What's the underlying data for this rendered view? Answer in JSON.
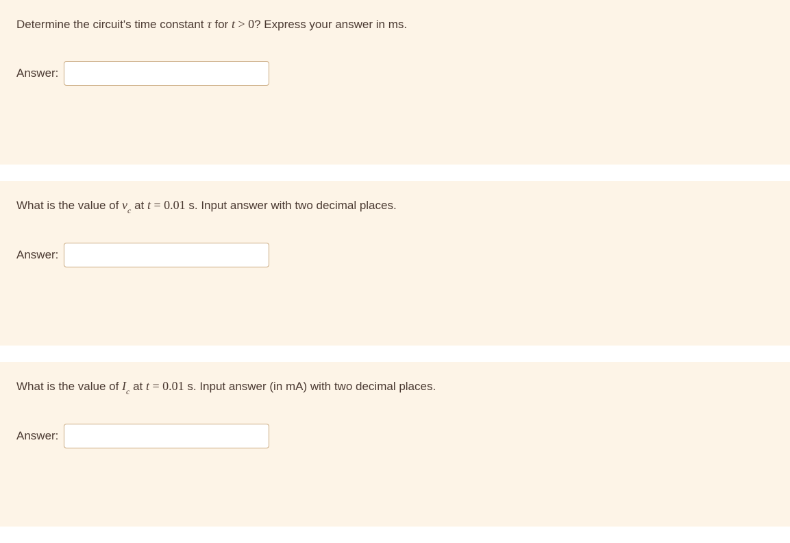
{
  "questions": [
    {
      "prompt_parts": {
        "p0": "Determine the circuit's time constant ",
        "sym_tau": "τ",
        "p1": " for ",
        "sym_t": "t",
        "p2": " > ",
        "sym_zero": "0",
        "p3": "? Express your answer in ms."
      },
      "answer_label": "Answer:",
      "answer_value": ""
    },
    {
      "prompt_parts": {
        "p0": "What is the value of ",
        "sym_v": "v",
        "sym_sub_c": "c",
        "p1": " at ",
        "sym_t": "t",
        "p2": " = ",
        "sym_val": "0.01",
        "p3": " s. Input answer with two decimal places."
      },
      "answer_label": "Answer:",
      "answer_value": ""
    },
    {
      "prompt_parts": {
        "p0": "What is the value of ",
        "sym_I": "I",
        "sym_sub_c": "c",
        "p1": " at ",
        "sym_t": "t",
        "p2": " = ",
        "sym_val": "0.01",
        "p3": " s. Input answer (in mA) with two decimal places."
      },
      "answer_label": "Answer:",
      "answer_value": ""
    }
  ]
}
